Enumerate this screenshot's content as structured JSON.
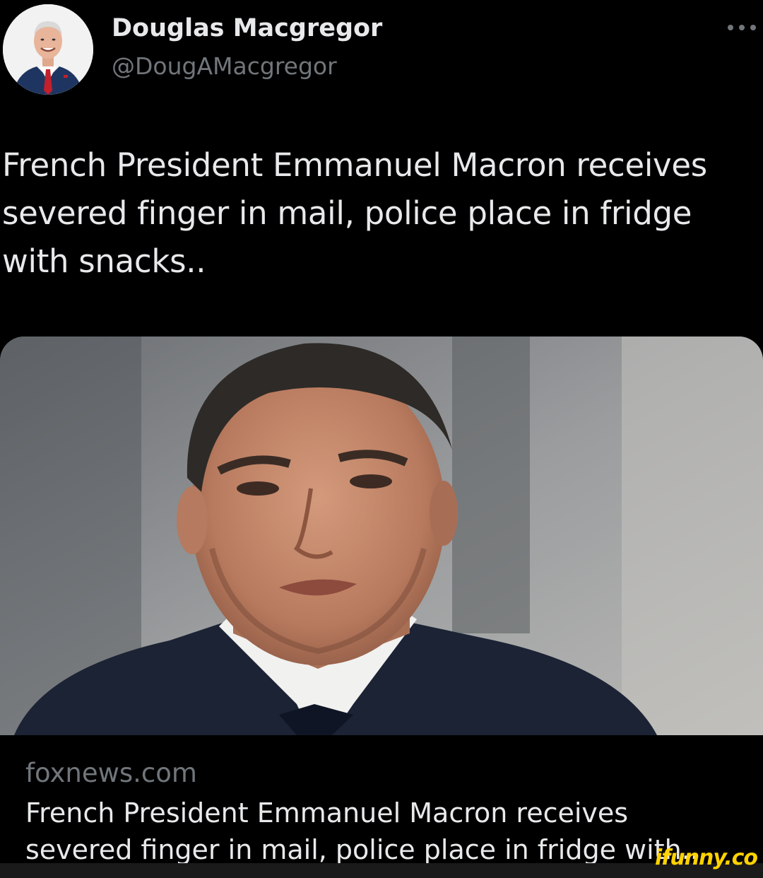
{
  "author": {
    "display_name": "Douglas Macgregor",
    "handle": "@DougAMacgregor",
    "avatar_icon": "profile-photo"
  },
  "more_icon": "more-options-icon",
  "tweet": {
    "text": "French President Emmanuel Macron receives severed finger in mail, police place in fridge with snacks.."
  },
  "link_card": {
    "domain": "foxnews.com",
    "title": "French President Emmanuel Macron receives severed finger in mail, police place in fridge with..."
  },
  "watermark": {
    "text": "ifunny.co"
  },
  "colors": {
    "background": "#000000",
    "text_primary": "#e7e9ea",
    "text_secondary": "#71767b",
    "watermark": "#ffd200"
  }
}
